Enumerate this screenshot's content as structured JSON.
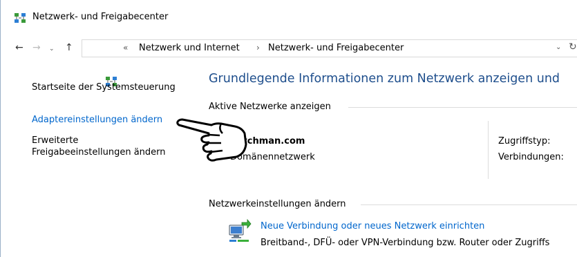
{
  "window": {
    "title": "Netzwerk- und Freigabecenter",
    "icon": "network-center-icon"
  },
  "nav": {
    "back": "←",
    "forward": "→",
    "recent": "⌄",
    "up": "↑",
    "breadcrumb_sep_start": "«",
    "breadcrumbs": [
      "Netzwerk und Internet",
      "Netzwerk- und Freigabecenter"
    ],
    "breadcrumb_sep": "›",
    "dropdown": "⌄",
    "refresh": "↻"
  },
  "sidebar": {
    "items": [
      {
        "label": "Startseite der Systemsteuerung"
      },
      {
        "label": "Adaptereinstellungen ändern"
      },
      {
        "label_line1": "Erweiterte",
        "label_line2": "Freigabeeinstellungen ändern"
      }
    ]
  },
  "main": {
    "title": "Grundlegende Informationen zum Netzwerk anzeigen und",
    "active_networks_header": "Aktive Netzwerke anzeigen",
    "network": {
      "name": "dutchman.com",
      "type": "Domänennetzwerk",
      "access_type_label": "Zugriffstyp:",
      "connections_label": "Verbindungen:"
    },
    "change_settings_header": "Netzwerkeinstellungen ändern",
    "new_connection": {
      "link": "Neue Verbindung oder neues Netzwerk einrichten",
      "description": "Breitband-, DFÜ- oder VPN-Verbindung bzw. Router oder Zugriffs"
    }
  },
  "colors": {
    "link": "#0066cc",
    "title_blue": "#1e4e8c"
  }
}
